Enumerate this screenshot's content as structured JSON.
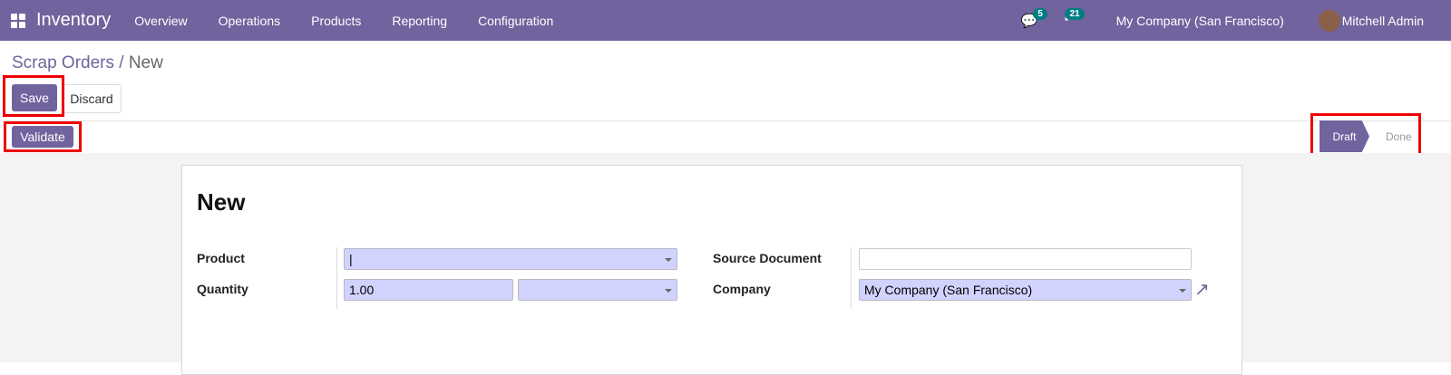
{
  "nav": {
    "app": "Inventory",
    "menu": [
      "Overview",
      "Operations",
      "Products",
      "Reporting",
      "Configuration"
    ],
    "messages_count": "5",
    "activity_count": "21",
    "company": "My Company (San Francisco)",
    "user": "Mitchell Admin"
  },
  "breadcrumb": {
    "parent": "Scrap Orders",
    "sep": "/",
    "current": "New"
  },
  "buttons": {
    "save": "Save",
    "discard": "Discard",
    "validate": "Validate"
  },
  "status": {
    "stages": [
      "Draft",
      "Done"
    ],
    "active": "Draft"
  },
  "form": {
    "title": "New",
    "product_label": "Product",
    "product_value": "",
    "quantity_label": "Quantity",
    "quantity_value": "1.00",
    "uom_value": "",
    "source_label": "Source Document",
    "source_value": "",
    "company_label": "Company",
    "company_value": "My Company (San Francisco)"
  },
  "colors": {
    "brand": "#71639e",
    "highlight": "#e00000",
    "required_field": "#d2d2ff"
  }
}
